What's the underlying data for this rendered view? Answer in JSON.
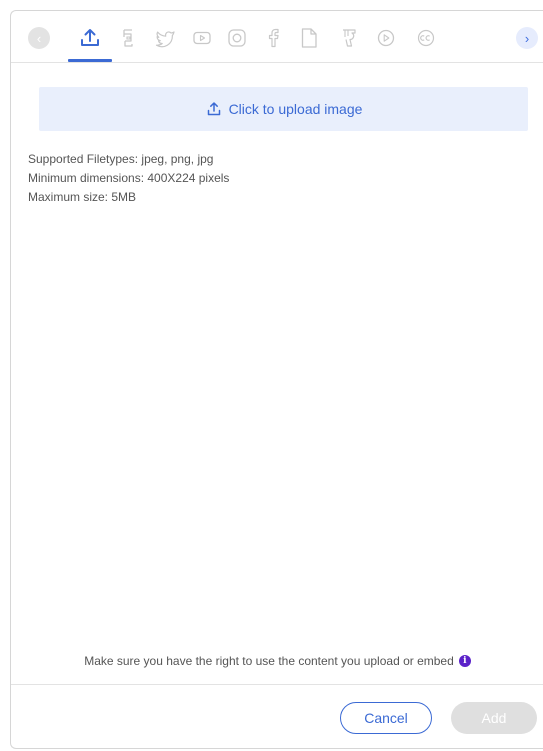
{
  "toolbar": {
    "prev_icon": "‹",
    "next_icon": "›",
    "tabs": [
      {
        "name": "upload-icon",
        "active": true
      },
      {
        "name": "giphy-icon",
        "active": false
      },
      {
        "name": "twitter-icon",
        "active": false
      },
      {
        "name": "youtube-icon",
        "active": false
      },
      {
        "name": "instagram-icon",
        "active": false
      },
      {
        "name": "facebook-icon",
        "active": false
      },
      {
        "name": "document-icon",
        "active": false
      },
      {
        "name": "soundcloud-icon",
        "active": false
      },
      {
        "name": "play-icon",
        "active": false
      },
      {
        "name": "creative-commons-icon",
        "active": false
      }
    ]
  },
  "upload": {
    "label": "Click to upload image"
  },
  "info": {
    "filetypes": "Supported Filetypes: jpeg, png, jpg",
    "dimensions": "Minimum dimensions: 400X224 pixels",
    "max_size": "Maximum size: 5MB"
  },
  "footer": {
    "disclaimer": "Make sure you have the right to use the content you upload or embed",
    "cancel_label": "Cancel",
    "add_label": "Add"
  },
  "colors": {
    "accent": "#3b6ad4",
    "upload_bg": "#e9effc",
    "info_icon": "#5b22c9",
    "disabled": "#dfdfdf"
  }
}
